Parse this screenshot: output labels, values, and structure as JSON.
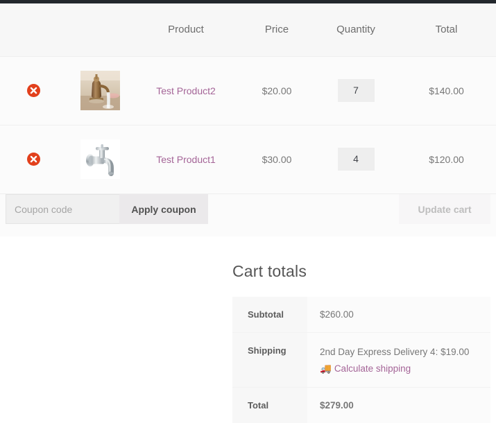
{
  "colors": {
    "admin_bar": "#23282d",
    "remove_button": "#e2401c",
    "link_purple": "#a46497",
    "header_bg": "#f7f7f7",
    "row_bg": "#fbfbfb"
  },
  "cart_table": {
    "headers": [
      "",
      "",
      "Product",
      "Price",
      "Quantity",
      "Total"
    ],
    "rows": [
      {
        "remove_label": "×",
        "remove_title": "Remove this item",
        "thumb": "bronze-faucet-image",
        "product": "Test Product2",
        "price": "$20.00",
        "quantity": "7",
        "total": "$140.00"
      },
      {
        "remove_label": "×",
        "remove_title": "Remove this item",
        "thumb": "chrome-tap-image",
        "product": "Test Product1",
        "price": "$30.00",
        "quantity": "4",
        "total": "$120.00"
      }
    ]
  },
  "actions": {
    "coupon_placeholder": "Coupon code",
    "coupon_value": "",
    "apply_label": "Apply coupon",
    "update_label": "Update cart"
  },
  "cart_totals": {
    "title": "Cart totals",
    "subtotal_label": "Subtotal",
    "subtotal_value": "$260.00",
    "shipping_label": "Shipping",
    "shipping_method": "2nd Day Express Delivery 4: $19.00",
    "calculate_icon": "truck-icon",
    "calculate_label": "Calculate shipping",
    "total_label": "Total",
    "total_value": "$279.00"
  }
}
